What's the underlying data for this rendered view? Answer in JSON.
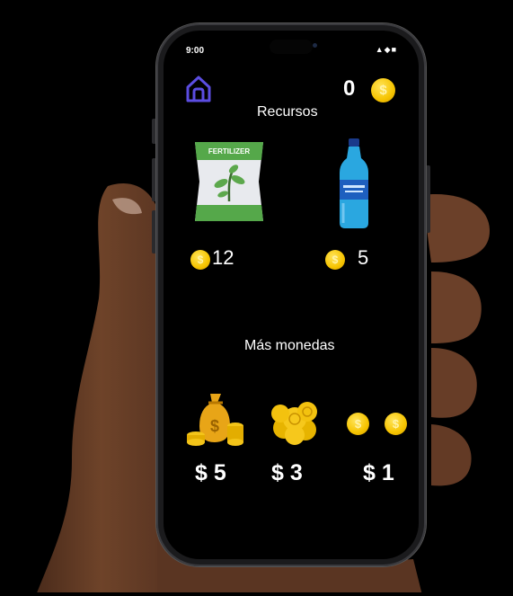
{
  "status_bar": {
    "time": "9:00",
    "icons": "▲◆■"
  },
  "header": {
    "coin_count": "0"
  },
  "sections": {
    "resources_title": "Recursos",
    "more_coins_title": "Más monedas"
  },
  "resources": [
    {
      "name": "fertilizer",
      "label": "FERTILIZER",
      "price": "12"
    },
    {
      "name": "water-bottle",
      "price": "5"
    }
  ],
  "coin_packs": [
    {
      "name": "money-bag",
      "price": "$ 5"
    },
    {
      "name": "coin-pile",
      "price": "$ 3"
    },
    {
      "name": "two-coins",
      "price": "$ 1"
    }
  ],
  "colors": {
    "accent": "#5b4de1",
    "coin": "#f6c400",
    "fertilizer_green": "#55a84a"
  }
}
